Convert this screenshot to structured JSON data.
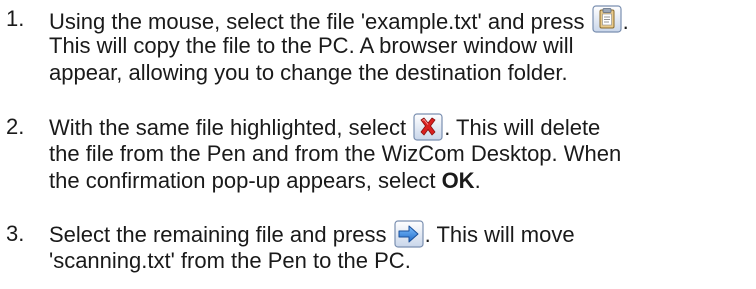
{
  "steps": [
    {
      "number": "1.",
      "line1_before_icon": "Using the mouse, select the file 'example.txt' and press ",
      "line1_after_icon": ".",
      "line2": "This will copy the file to the PC. A browser window will",
      "line3": "appear, allowing you to change the destination folder.",
      "icon": "copy-clipboard-icon"
    },
    {
      "number": "2.",
      "line1_before_icon": "With the same file highlighted, select ",
      "line1_after_icon": ". This will delete",
      "line2": "the file from the Pen and from the WizCom Desktop. When",
      "line3_before_bold": "the confirmation pop-up appears, select ",
      "line3_bold": "OK",
      "line3_after_bold": ".",
      "icon": "delete-x-icon"
    },
    {
      "number": "3.",
      "line1_before_icon": "Select the remaining file and press ",
      "line1_after_icon": ". This will move",
      "line2": "'scanning.txt' from the Pen to the PC.",
      "icon": "move-arrow-icon"
    }
  ],
  "colors": {
    "text": "#1a1a1a",
    "icon_frame": "#7a8fb0",
    "delete_red": "#d92020",
    "arrow_blue": "#2f7fd8"
  }
}
